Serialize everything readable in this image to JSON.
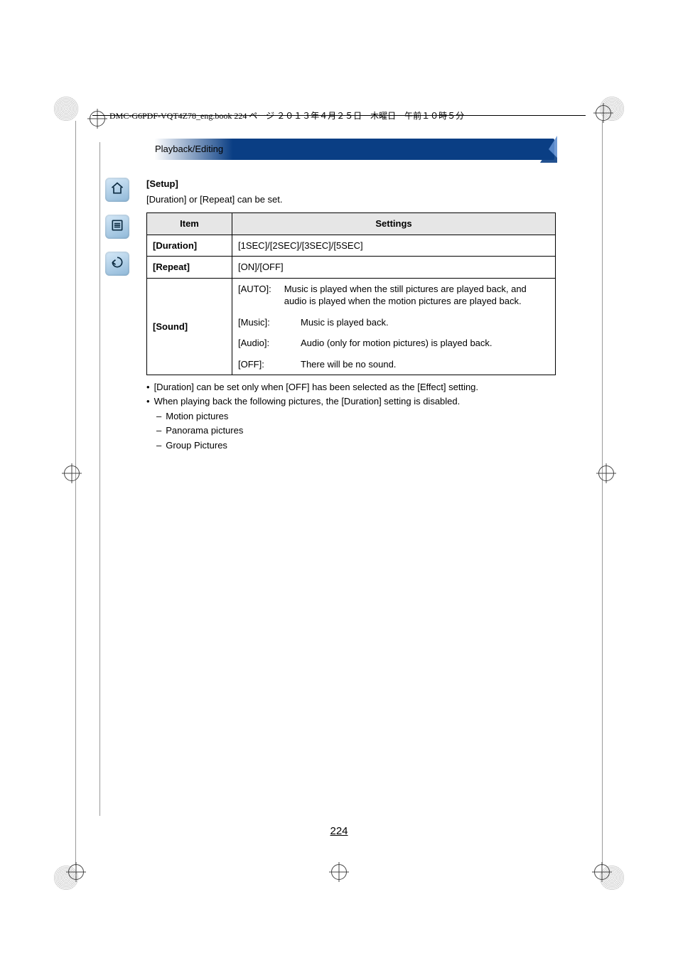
{
  "header": {
    "file_info": "DMC-G6PDF-VQT4Z78_eng.book  224 ページ  ２０１３年４月２５日　木曜日　午前１０時５分"
  },
  "section": {
    "breadcrumb": "Playback/Editing"
  },
  "setup": {
    "heading": "[Setup]",
    "subtext": "[Duration] or [Repeat] can be set."
  },
  "table": {
    "headers": {
      "item": "Item",
      "settings": "Settings"
    },
    "rows": {
      "duration": {
        "label": "[Duration]",
        "value": "[1SEC]/[2SEC]/[3SEC]/[5SEC]"
      },
      "repeat": {
        "label": "[Repeat]",
        "value": "[ON]/[OFF]"
      },
      "sound": {
        "label": "[Sound]",
        "options": [
          {
            "key": "[AUTO]:",
            "desc": "Music is played when the still pictures are played back, and audio is played when the motion pictures are played back."
          },
          {
            "key": "[Music]:",
            "desc": "Music is played back."
          },
          {
            "key": "[Audio]:",
            "desc": "Audio (only for motion pictures) is played back."
          },
          {
            "key": "[OFF]:",
            "desc": "There will be no sound."
          }
        ]
      }
    }
  },
  "notes": {
    "b1": "[Duration] can be set only when [OFF] has been selected as the [Effect] setting.",
    "b2": "When playing back the following pictures, the [Duration] setting is disabled.",
    "d1": "Motion pictures",
    "d2": "Panorama pictures",
    "d3": "Group Pictures"
  },
  "page": {
    "number": "224"
  },
  "icons": {
    "home": "home-icon",
    "list": "list-icon",
    "back": "back-icon"
  }
}
